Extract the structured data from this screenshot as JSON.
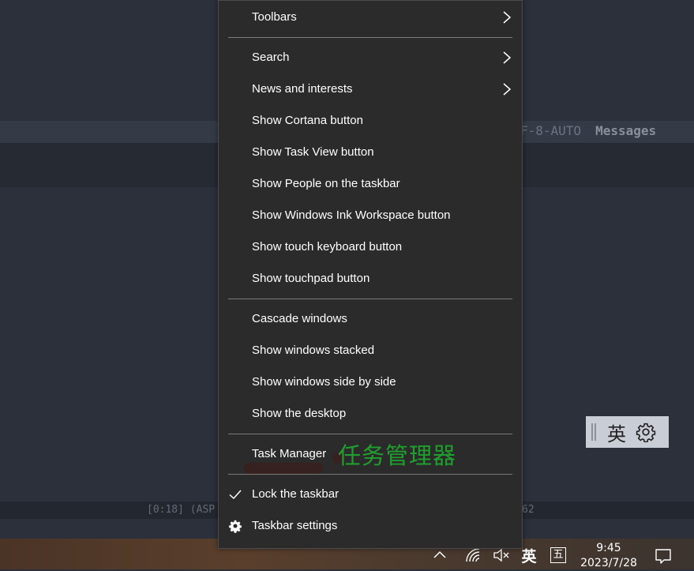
{
  "background": {
    "modeline_left": "F-8-AUTO",
    "modeline_right": "Messages",
    "echo_text": "[0:18] (ASP",
    "echo_right": "62"
  },
  "menu": {
    "items": [
      {
        "label": "Toolbars",
        "submenu": true
      },
      {
        "label": "Search",
        "submenu": true
      },
      {
        "label": "News and interests",
        "submenu": true
      },
      {
        "label": "Show Cortana button"
      },
      {
        "label": "Show Task View button"
      },
      {
        "label": "Show People on the taskbar"
      },
      {
        "label": "Show Windows Ink Workspace button"
      },
      {
        "label": "Show touch keyboard button"
      },
      {
        "label": "Show touchpad button"
      },
      {
        "label": "Cascade windows"
      },
      {
        "label": "Show windows stacked"
      },
      {
        "label": "Show windows side by side"
      },
      {
        "label": "Show the desktop"
      },
      {
        "label": "Task Manager"
      },
      {
        "label": "Lock the taskbar",
        "icon": "checkmark-icon"
      },
      {
        "label": "Taskbar settings",
        "icon": "gear-icon"
      }
    ]
  },
  "annotation": {
    "text": "任务管理器",
    "color": "#1fa02e"
  },
  "ime_toolbar": {
    "language": "英",
    "settings_icon": "gear-icon"
  },
  "taskbar": {
    "tray": {
      "chevron_icon": "chevron-up-icon",
      "network_icon": "wifi-icon",
      "volume_icon": "volume-muted-icon",
      "language": "英",
      "ime_mode": "五",
      "time": "9:45",
      "date": "2023/7/28",
      "notification_icon": "notification-icon"
    }
  }
}
